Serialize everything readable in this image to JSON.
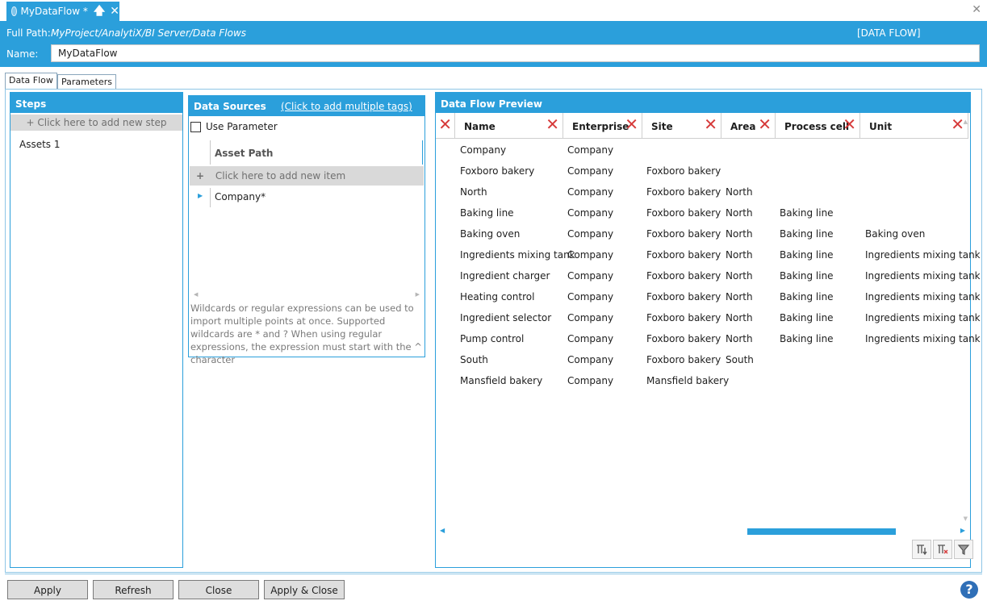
{
  "doc_tab": {
    "title": "MyDataFlow *"
  },
  "header": {
    "full_path_label": "Full Path:",
    "full_path_value": "MyProject/AnalytiX/BI Server/Data Flows",
    "type_label": "[DATA FLOW]",
    "name_label": "Name:",
    "name_value": "MyDataFlow"
  },
  "tabs": {
    "data_flow": "Data Flow",
    "parameters": "Parameters"
  },
  "steps": {
    "title": "Steps",
    "add_label": "+ Click here to add new step",
    "items": [
      {
        "label": "Assets  1"
      }
    ]
  },
  "data_sources": {
    "title": "Data Sources",
    "link": "(Click to add multiple tags)",
    "use_parameter": "Use Parameter",
    "column": "Asset Path",
    "add_label": "Click here to add new item",
    "add_plus": "+",
    "items": [
      {
        "label": "Company*"
      }
    ],
    "help": "Wildcards or regular expressions can be used to import multiple points at once. Supported wildcards are * and ? When using regular expressions, the expression must start with the ^ character"
  },
  "preview": {
    "title": "Data Flow Preview",
    "columns": [
      "Name",
      "Enterprise",
      "Site",
      "Area",
      "Process cell",
      "Unit"
    ],
    "rows": [
      [
        "Company",
        "Company",
        "",
        "",
        "",
        ""
      ],
      [
        "Foxboro bakery",
        "Company",
        "Foxboro bakery",
        "",
        "",
        ""
      ],
      [
        "North",
        "Company",
        "Foxboro bakery",
        "North",
        "",
        ""
      ],
      [
        "Baking line",
        "Company",
        "Foxboro bakery",
        "North",
        "Baking line",
        ""
      ],
      [
        "Baking oven",
        "Company",
        "Foxboro bakery",
        "North",
        "Baking line",
        "Baking oven"
      ],
      [
        "Ingredients mixing tank",
        "Company",
        "Foxboro bakery",
        "North",
        "Baking line",
        "Ingredients mixing tank"
      ],
      [
        "Ingredient charger",
        "Company",
        "Foxboro bakery",
        "North",
        "Baking line",
        "Ingredients mixing tank"
      ],
      [
        "Heating control",
        "Company",
        "Foxboro bakery",
        "North",
        "Baking line",
        "Ingredients mixing tank"
      ],
      [
        "Ingredient selector",
        "Company",
        "Foxboro bakery",
        "North",
        "Baking line",
        "Ingredients mixing tank"
      ],
      [
        "Pump control",
        "Company",
        "Foxboro bakery",
        "North",
        "Baking line",
        "Ingredients mixing tank"
      ],
      [
        "South",
        "Company",
        "Foxboro bakery",
        "South",
        "",
        ""
      ],
      [
        "Mansfield bakery",
        "Company",
        "Mansfield bakery",
        "",
        "",
        ""
      ]
    ]
  },
  "footer": {
    "apply": "Apply",
    "refresh": "Refresh",
    "close": "Close",
    "apply_close": "Apply & Close",
    "help": "?"
  },
  "colors": {
    "accent": "#2b9fdb",
    "remove": "#d63a3a",
    "help": "#2f6fb7"
  },
  "icons": [
    "data-flow-icon",
    "pin-icon",
    "close-icon",
    "remove-column-icon",
    "filter-icon",
    "help-icon",
    "expand-arrow-icon"
  ]
}
